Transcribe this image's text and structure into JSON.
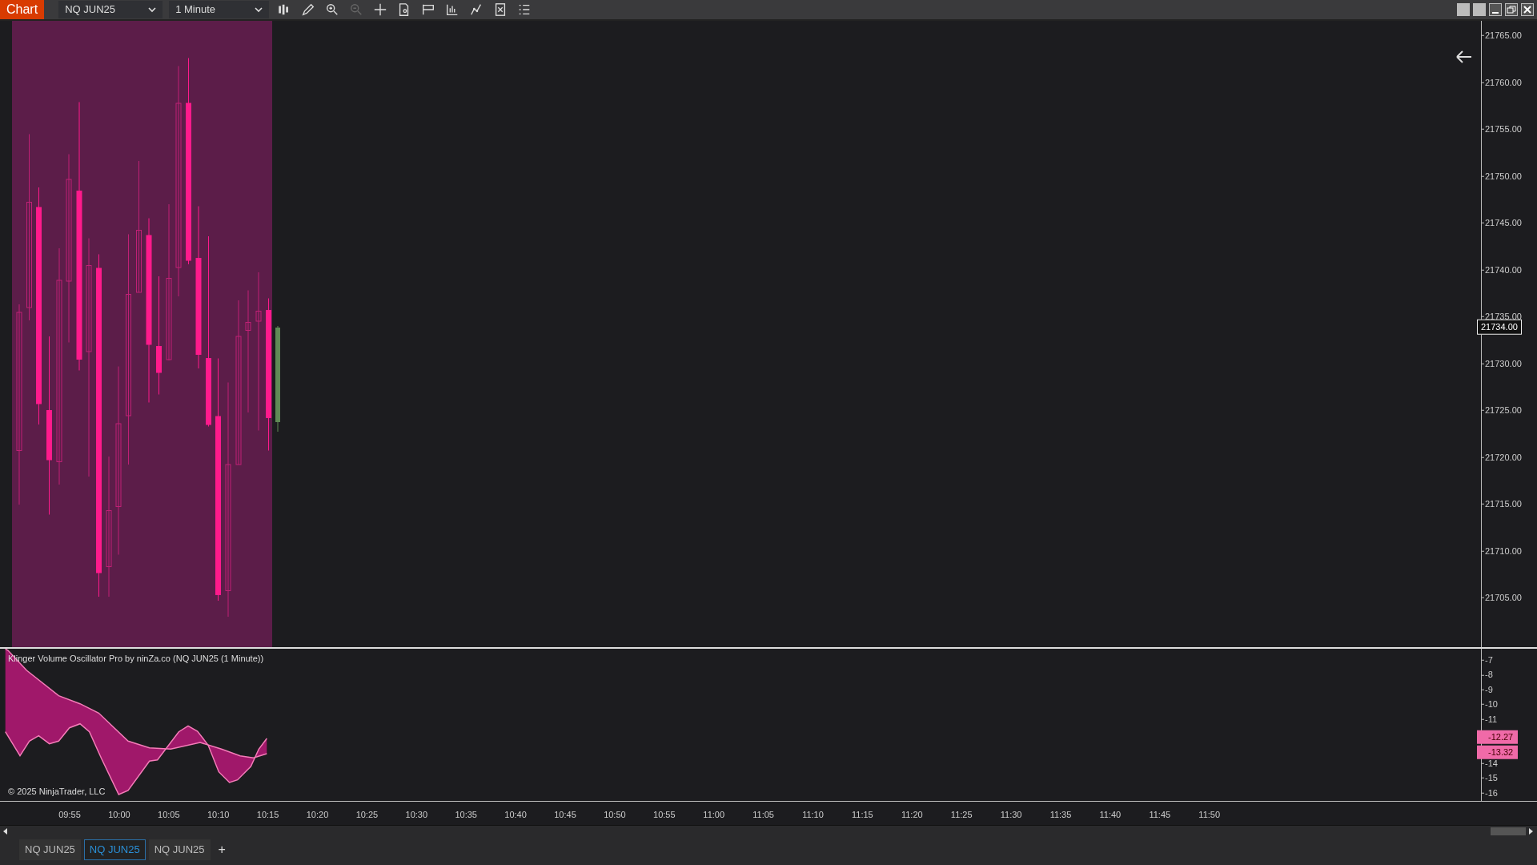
{
  "toolbar": {
    "title": "Chart",
    "instrument": "NQ JUN25",
    "interval": "1 Minute"
  },
  "price_axis": {
    "ticks": [
      "21765.00",
      "21760.00",
      "21755.00",
      "21750.00",
      "21745.00",
      "21740.00",
      "21735.00",
      "21730.00",
      "21725.00",
      "21720.00",
      "21715.00",
      "21710.00",
      "21705.00"
    ],
    "current_price": "21734.00"
  },
  "indicator": {
    "title": "Klinger Volume Oscillator Pro by ninZa.co (NQ JUN25 (1 Minute))",
    "copyright": "© 2025 NinjaTrader, LLC",
    "upper_ticks": [
      "-7",
      "-8",
      "-9",
      "-10",
      "-11"
    ],
    "lower_ticks": [
      "-14",
      "-15",
      "-16"
    ],
    "value_tags": [
      "-12.27",
      "-13.32"
    ]
  },
  "time_axis": {
    "ticks": [
      "09:55",
      "10:00",
      "10:05",
      "10:10",
      "10:15",
      "10:20",
      "10:25",
      "10:30",
      "10:35",
      "10:40",
      "10:45",
      "10:50",
      "10:55",
      "11:00",
      "11:05",
      "11:10",
      "11:15",
      "11:20",
      "11:25",
      "11:30",
      "11:35",
      "11:40",
      "11:45",
      "11:50"
    ]
  },
  "tabs": [
    {
      "label": "NQ JUN25",
      "selected": false
    },
    {
      "label": "NQ JUN25",
      "selected": true
    },
    {
      "label": "NQ JUN25",
      "selected": false
    }
  ],
  "new_tab_button": "+"
}
